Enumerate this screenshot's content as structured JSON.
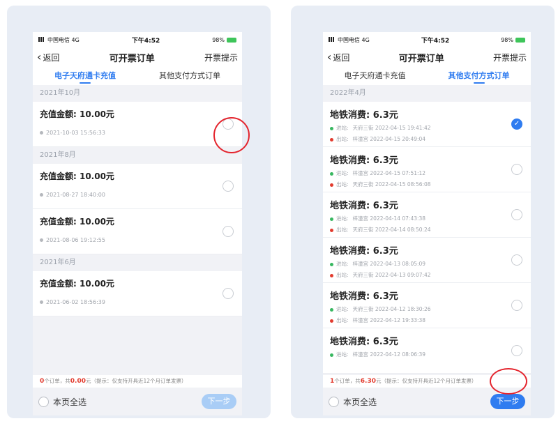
{
  "left": {
    "status": {
      "carrier": "中国电信 4G",
      "time": "下午4:52",
      "battery": "98%"
    },
    "nav": {
      "back": "返回",
      "title": "可开票订单",
      "right": "开票提示"
    },
    "tabs": [
      {
        "label": "电子天府通卡充值",
        "active": true
      },
      {
        "label": "其他支付方式订单",
        "active": false
      }
    ],
    "groups": [
      {
        "month": "2021年10月",
        "items": [
          {
            "title": "充值金额: 10.00元",
            "time": "2021-10-03 15:56:33"
          }
        ]
      },
      {
        "month": "2021年8月",
        "items": [
          {
            "title": "充值金额: 10.00元",
            "time": "2021-08-27 18:40:00"
          },
          {
            "title": "充值金额: 10.00元",
            "time": "2021-08-06 19:12:55"
          }
        ]
      },
      {
        "month": "2021年6月",
        "items": [
          {
            "title": "充值金额: 10.00元",
            "time": "2021-06-02 18:56:39"
          }
        ]
      }
    ],
    "summary": {
      "count": "0",
      "mid": "个订单，共",
      "amount": "0.00",
      "tail": "元（提示：仅支持开具近12个月订单发票）"
    },
    "select_all": "本页全选",
    "next": "下一步"
  },
  "right": {
    "status": {
      "carrier": "中国电信 4G",
      "time": "下午4:52",
      "battery": "98%"
    },
    "nav": {
      "back": "返回",
      "title": "可开票订单",
      "right": "开票提示"
    },
    "tabs": [
      {
        "label": "电子天府通卡充值",
        "active": false
      },
      {
        "label": "其他支付方式订单",
        "active": true
      }
    ],
    "month": "2022年4月",
    "items": [
      {
        "title": "地铁消费: 6.3元",
        "in_label": "进站:",
        "in": "天府三街 2022-04-15 19:41:42",
        "out_label": "出站:",
        "out": "梓潼宫 2022-04-15 20:49:04",
        "checked": true
      },
      {
        "title": "地铁消费: 6.3元",
        "in_label": "进站:",
        "in": "梓潼宫 2022-04-15 07:51:12",
        "out_label": "出站:",
        "out": "天府三街 2022-04-15 08:56:08",
        "checked": false
      },
      {
        "title": "地铁消费: 6.3元",
        "in_label": "进站:",
        "in": "梓潼宫 2022-04-14 07:43:38",
        "out_label": "出站:",
        "out": "天府三街 2022-04-14 08:50:24",
        "checked": false
      },
      {
        "title": "地铁消费: 6.3元",
        "in_label": "进站:",
        "in": "梓潼宫 2022-04-13 08:05:09",
        "out_label": "出站:",
        "out": "天府三街 2022-04-13 09:07:42",
        "checked": false
      },
      {
        "title": "地铁消费: 6.3元",
        "in_label": "进站:",
        "in": "天府三街 2022-04-12 18:30:26",
        "out_label": "出站:",
        "out": "梓潼宫 2022-04-12 19:33:38",
        "checked": false
      },
      {
        "title": "地铁消费: 6.3元",
        "in_label": "进站:",
        "in": "梓潼宫 2022-04-12 08:06:39",
        "out_label": "出站:",
        "out": "",
        "checked": false
      }
    ],
    "summary": {
      "count": "1",
      "mid": "个订单，共",
      "amount": "6.30",
      "tail": "元（提示：仅支持开具近12个月订单发票）"
    },
    "select_all": "本页全选",
    "next": "下一步"
  },
  "colors": {
    "accent": "#2f7cf0",
    "annotation": "#e4242d",
    "price": "#e23b2e"
  }
}
